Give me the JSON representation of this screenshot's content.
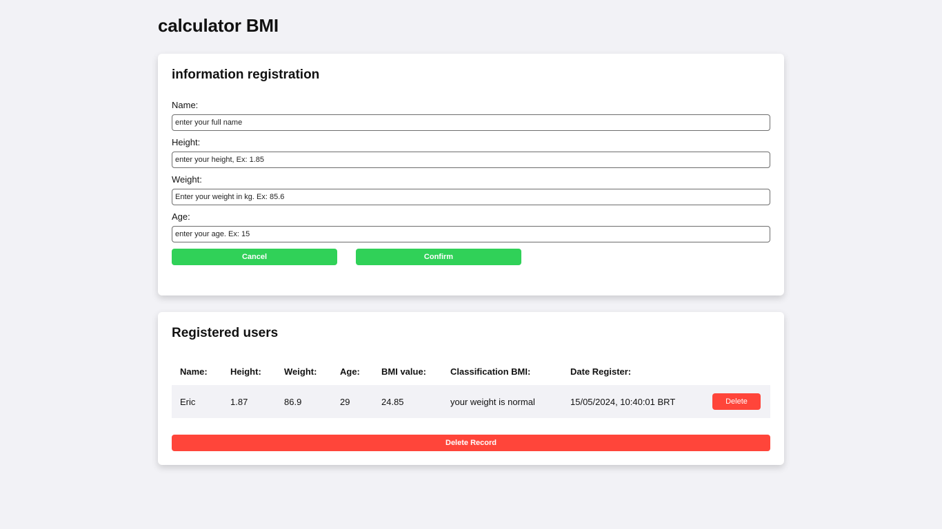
{
  "page": {
    "title": "calculator BMI"
  },
  "form": {
    "title": "information registration",
    "fields": [
      {
        "label": "Name:",
        "placeholder": "enter your full name"
      },
      {
        "label": "Height:",
        "placeholder": "enter your height, Ex: 1.85"
      },
      {
        "label": "Weight:",
        "placeholder": "Enter your weight in kg. Ex: 85.6"
      },
      {
        "label": "Age:",
        "placeholder": "enter your age. Ex: 15"
      }
    ],
    "cancel_label": "Cancel",
    "confirm_label": "Confirm"
  },
  "users": {
    "title": "Registered users",
    "columns": [
      "Name:",
      "Height:",
      "Weight:",
      "Age:",
      "BMI value:",
      "Classification BMI:",
      "Date Register:"
    ],
    "rows": [
      {
        "name": "Eric",
        "height": "1.87",
        "weight": "86.9",
        "age": "29",
        "bmi": "24.85",
        "classification": "your weight is normal",
        "date": "15/05/2024, 10:40:01 BRT",
        "delete_label": "Delete"
      }
    ],
    "delete_record_label": "Delete Record"
  },
  "colors": {
    "background": "#f2f2f6",
    "primary_green": "#30d158",
    "danger_red": "#ff453a"
  }
}
